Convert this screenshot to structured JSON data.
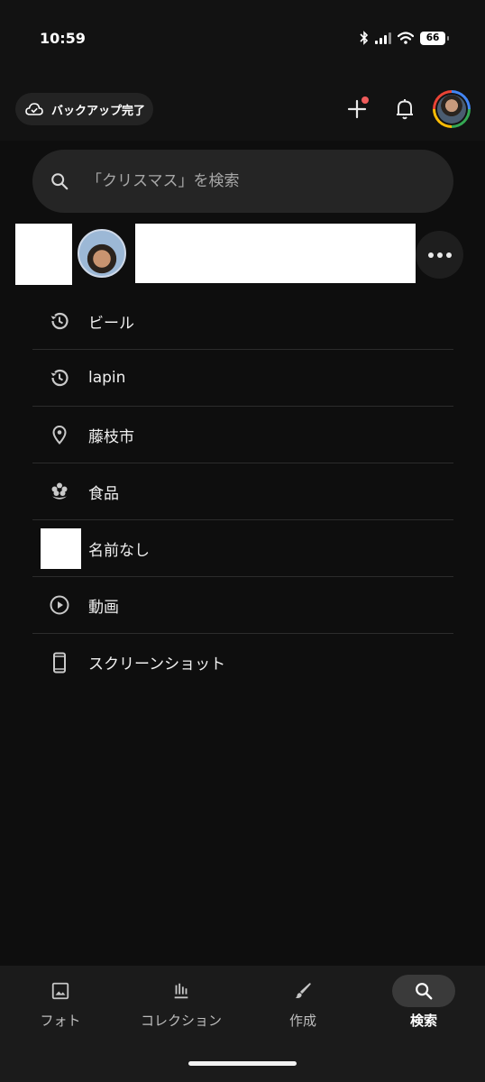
{
  "status_bar": {
    "time": "10:59",
    "battery": "66",
    "icons": [
      "bluetooth-icon",
      "signal-icon",
      "wifi-icon",
      "battery-icon"
    ]
  },
  "header": {
    "backup_label": "バックアップ完了",
    "icons": [
      "cloud-check-icon",
      "plus-icon",
      "bell-icon",
      "account-avatar"
    ],
    "notification_dot_color": "#ef5b5b"
  },
  "search": {
    "placeholder": "「クリスマス」を検索",
    "value": ""
  },
  "people_row": {
    "more_icon": "more-horizontal-icon"
  },
  "suggestions": [
    {
      "label": "ビール",
      "icon": "history-icon"
    },
    {
      "label": "lapin",
      "icon": "history-icon"
    },
    {
      "label": "藤枝市",
      "icon": "location-pin-icon"
    },
    {
      "label": "食品",
      "icon": "flower-icon"
    },
    {
      "label": "名前なし",
      "icon": "redacted-thumbnail"
    },
    {
      "label": "動画",
      "icon": "play-circle-icon"
    },
    {
      "label": "スクリーンショット",
      "icon": "phone-icon"
    }
  ],
  "bottom_nav": {
    "items": [
      {
        "label": "フォト",
        "icon": "photo-icon",
        "active": false
      },
      {
        "label": "コレクション",
        "icon": "collections-icon",
        "active": false
      },
      {
        "label": "作成",
        "icon": "brush-icon",
        "active": false
      },
      {
        "label": "検索",
        "icon": "search-icon",
        "active": true
      }
    ]
  },
  "colors": {
    "background": "#0e0e0e",
    "surface": "#252525",
    "text": "#f0f0f0",
    "avatar_ring": [
      "#4285f4",
      "#34a853",
      "#fbbc05",
      "#ea4335"
    ]
  }
}
